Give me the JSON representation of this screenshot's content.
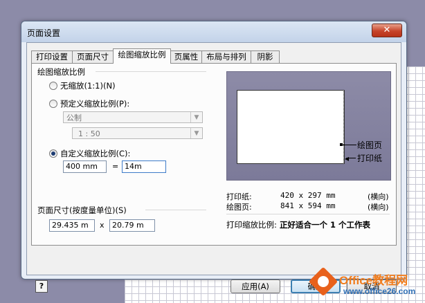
{
  "dialog": {
    "title": "页面设置",
    "close_label": "✕"
  },
  "tabs": [
    {
      "label": "打印设置"
    },
    {
      "label": "页面尺寸"
    },
    {
      "label": "绘图缩放比例"
    },
    {
      "label": "页属性"
    },
    {
      "label": "布局与排列"
    },
    {
      "label": "阴影"
    }
  ],
  "active_tab": "绘图缩放比例",
  "scale": {
    "group_label": "绘图缩放比例",
    "no_scale_label": "无缩放(1:1)(N)",
    "preset_label": "预定义缩放比例(P):",
    "preset_system": "公制",
    "preset_ratio": "1 : 50",
    "custom_label": "自定义缩放比例(C):",
    "custom_left": "400 mm",
    "equals": "=",
    "custom_right": "14m",
    "selected": "custom"
  },
  "page_size": {
    "group_label": "页面尺寸(按度量单位)(S)",
    "width": "29.435 m",
    "x_sep": "x",
    "height": "20.79 m"
  },
  "preview": {
    "drawing_page_label": "绘图页",
    "printer_paper_label": "打印纸"
  },
  "info": {
    "paper_label": "打印纸:",
    "paper_size": "420 x 297 mm",
    "paper_orient": "(横向)",
    "drawing_label": "绘图页:",
    "drawing_size": "841 x 594 mm",
    "drawing_orient": "(横向)",
    "zoom_label": "打印缩放比例:",
    "zoom_value": "正好适合一个 1 个工作表"
  },
  "buttons": {
    "help": "?",
    "apply": "应用(A)",
    "ok": "确定",
    "cancel": "取消"
  },
  "watermark": {
    "line1": "Office教程网",
    "line2": "www.office26.com"
  }
}
